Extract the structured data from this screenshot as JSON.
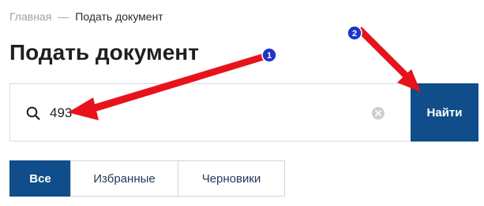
{
  "breadcrumb": {
    "home": "Главная",
    "separator": "—",
    "current": "Подать документ"
  },
  "page_title": "Подать документ",
  "search": {
    "value": "493",
    "button_label": "Найти",
    "icon": "search-icon",
    "clear_icon": "clear-icon"
  },
  "tabs": [
    {
      "label": "Все",
      "active": true
    },
    {
      "label": "Избранные",
      "active": false
    },
    {
      "label": "Черновики",
      "active": false
    }
  ],
  "annotations": {
    "badge_1": "1",
    "badge_2": "2",
    "arrow_color": "#e8121b",
    "badge_color": "#1d36c7"
  },
  "colors": {
    "accent": "#0f4e8a",
    "border": "#d5dbe1"
  }
}
